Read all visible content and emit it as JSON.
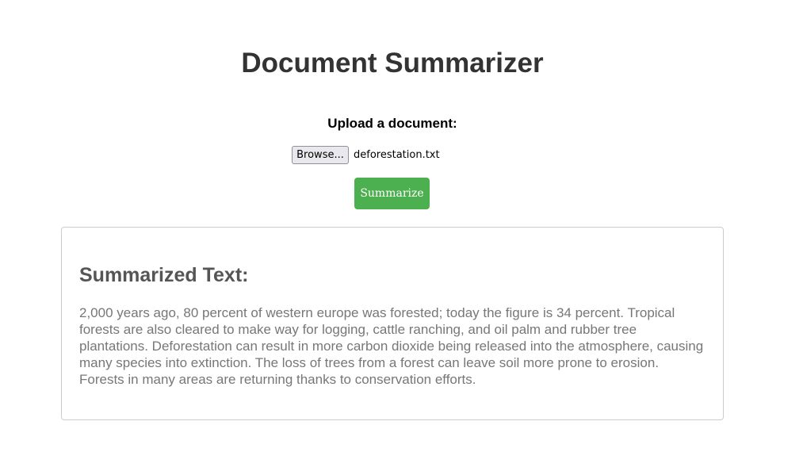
{
  "header": {
    "title": "Document Summarizer"
  },
  "upload": {
    "label": "Upload a document:",
    "browse_label": "Browse...",
    "file_name": "deforestation.txt"
  },
  "actions": {
    "summarize_label": "Summarize"
  },
  "summary": {
    "heading": "Summarized Text:",
    "text": "2,000 years ago, 80 percent of western europe was forested; today the figure is 34 percent. Tropical forests are also cleared to make way for logging, cattle ranching, and oil palm and rubber tree plantations. Deforestation can result in more carbon dioxide being released into the atmosphere, causing many species into extinction. The loss of trees from a forest can leave soil more prone to erosion. Forests in many areas are returning thanks to conservation efforts."
  },
  "colors": {
    "accent": "#4caf50",
    "title": "#333333",
    "heading": "#555555",
    "body_text": "#777777",
    "border": "#cccccc"
  }
}
